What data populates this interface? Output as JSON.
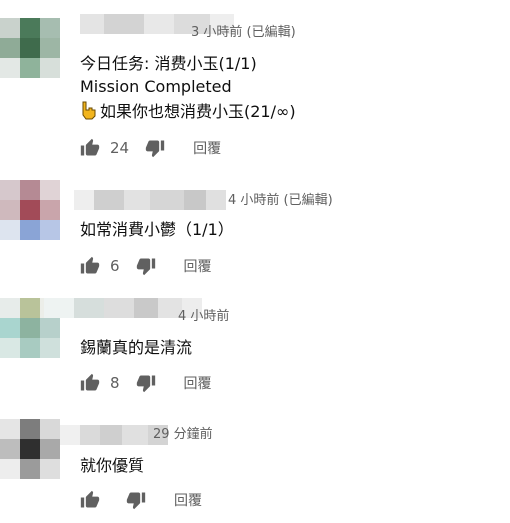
{
  "ui": {
    "reply_label": "回覆",
    "icons": [
      "thumb-up-icon",
      "thumb-down-icon",
      "pointing-finger-icon"
    ]
  },
  "comments": [
    {
      "meta": "3 小時前 (已編輯)",
      "lines": [
        "今日任务: 消费小玉(1/1)",
        "Mission Completed",
        "如果你也想消费小玉(21/∞)"
      ],
      "likes": "24",
      "avatar_colors": [
        "#c9d2cc",
        "#4b7a5a",
        "#a6bdb0",
        "#8fab97",
        "#3f6b4c",
        "#9db6a5",
        "#e3e8e5",
        "#8fb39b",
        "#d7dfda"
      ]
    },
    {
      "meta": "4 小時前 (已編輯)",
      "lines": [
        "如常消費小鬱（1/1）"
      ],
      "likes": "6",
      "avatar_colors": [
        "#d6c8cc",
        "#b58a94",
        "#e0d3d6",
        "#cfb9bd",
        "#a24b58",
        "#c9a5ab",
        "#dde4ef",
        "#8aa4d6",
        "#b7c6e6"
      ]
    },
    {
      "meta": "4 小時前",
      "lines": [
        "錫蘭真的是清流"
      ],
      "likes": "8",
      "avatar_colors": [
        "#e7ecea",
        "#b9c39a",
        "#eceee9",
        "#a9d5cf",
        "#8db3a0",
        "#b7d0cb",
        "#d9e8e4",
        "#a8cbc1",
        "#cfe0dc"
      ]
    },
    {
      "meta": "29 分鐘前",
      "lines": [
        "就你優質"
      ],
      "likes": "",
      "avatar_colors": [
        "#e5e5e5",
        "#7d7d7d",
        "#d9d9d9",
        "#bdbdbd",
        "#2f2f2f",
        "#a9a9a9",
        "#ededed",
        "#9b9b9b",
        "#dedede"
      ]
    }
  ]
}
